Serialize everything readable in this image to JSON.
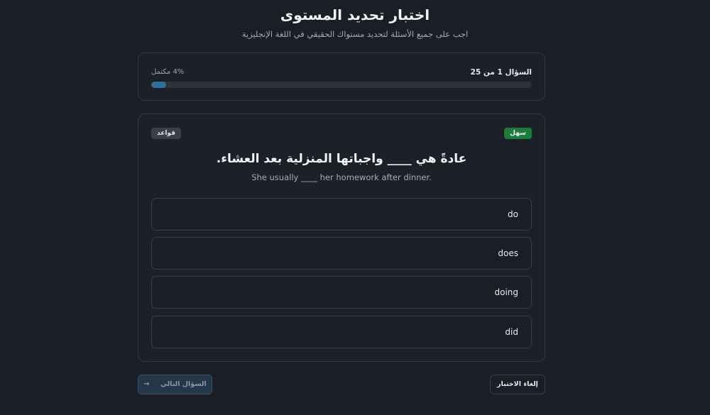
{
  "header": {
    "title": "اختبار تحديد المستوى",
    "subtitle": "اجب على جميع الأسئلة لتحديد مستواك الحقيقي في اللغة الإنجليزية"
  },
  "progress": {
    "question_label": "السؤال 1 من 25",
    "percent_label": "4% مكتمل",
    "percent": 4
  },
  "question": {
    "difficulty": "سهل",
    "category": "قواعد",
    "text": "عادةً هي ____ واجباتها المنزلية بعد العشاء.",
    "translation": "She usually ____ her homework after dinner.",
    "options": [
      "do",
      "does",
      "doing",
      "did"
    ]
  },
  "footer": {
    "cancel_label": "إلغاء الاختبار",
    "next_label": "السؤال التالي",
    "next_icon": "arrow-right-icon"
  }
}
